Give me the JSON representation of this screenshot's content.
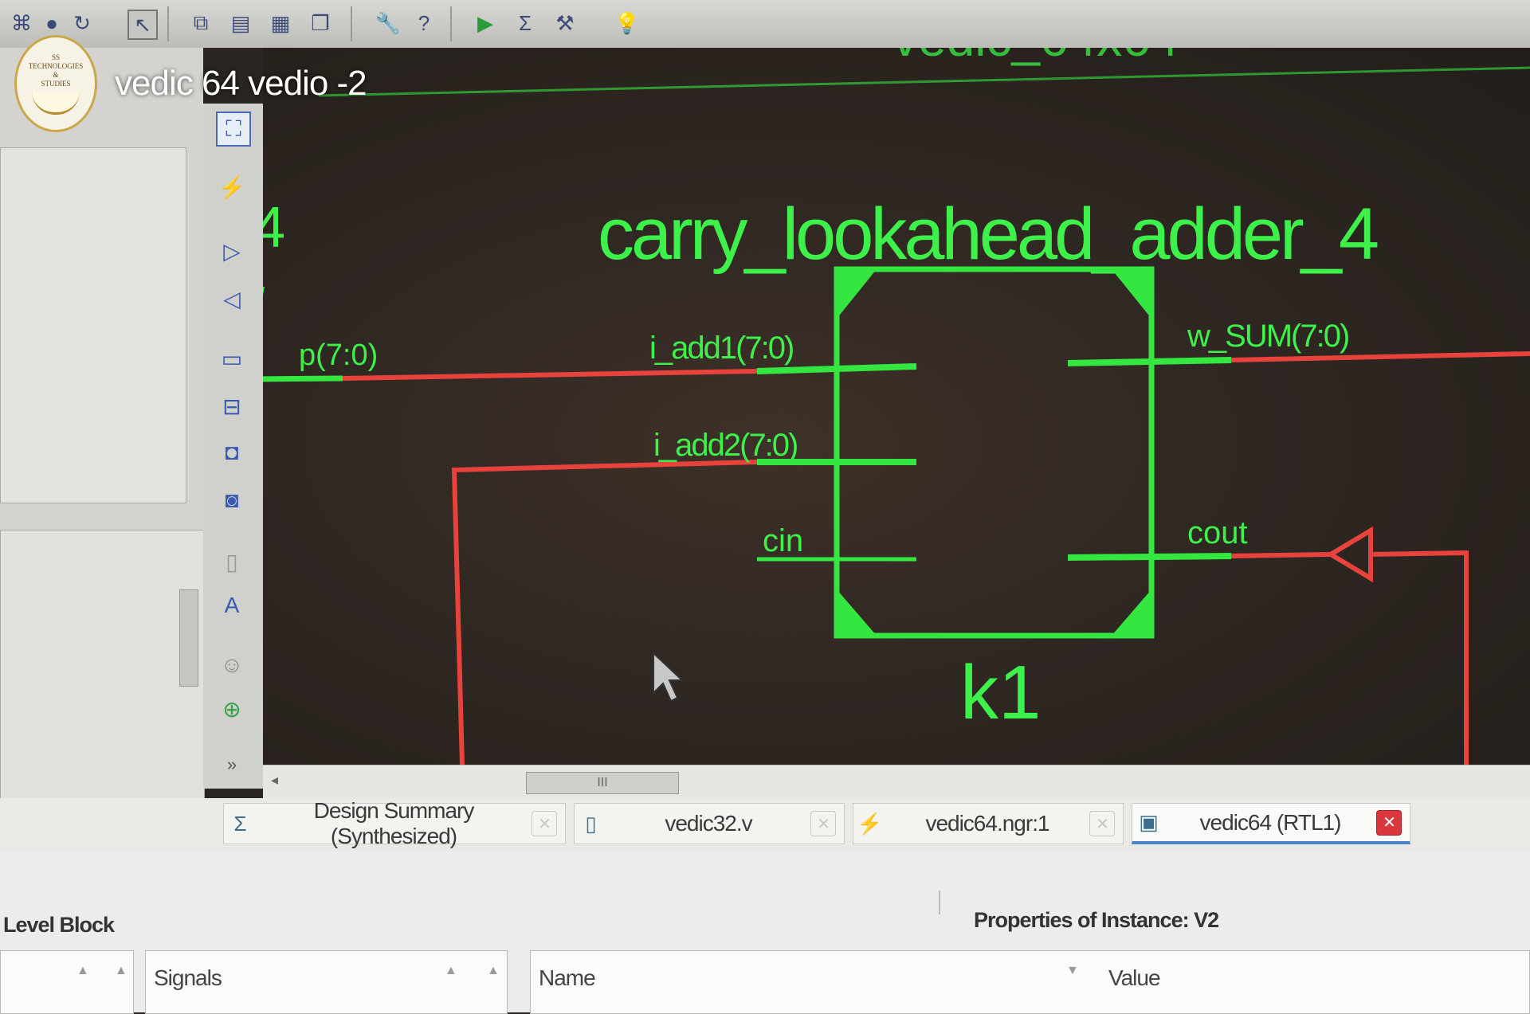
{
  "video": {
    "title": "vedic 64 vedio -2",
    "logo_lines": [
      "SS",
      "TECHNOLOGIES",
      "&",
      "STUDIES"
    ]
  },
  "toolbar": {
    "icons": [
      "hierarchy-icon",
      "record-icon",
      "refresh-icon",
      "pointer-icon",
      "window-cascade-icon",
      "window-split-icon",
      "window-tile-icon",
      "window-float-icon",
      "wrench-icon",
      "help-icon",
      "run-icon",
      "sigma-icon",
      "compile-icon",
      "bulb-icon"
    ]
  },
  "schematic": {
    "header_partial": "vedic_64x64",
    "left_block_partial": "4",
    "left_net": "p(7:0)",
    "block_title": "carry_lookahead_adder_4",
    "instance": "k1",
    "ports": {
      "in1": "i_add1(7:0)",
      "in2": "i_add2(7:0)",
      "cin": "cin",
      "out_sum": "w_SUM(7:0)",
      "cout": "cout"
    },
    "colors": {
      "wire_green": "#34e640",
      "wire_red": "#e8423c",
      "text_green": "#3ef04a"
    }
  },
  "hscroll": {
    "thumb_label": "III"
  },
  "tabs": [
    {
      "icon": "sigma-icon",
      "label": "Design Summary (Synthesized)",
      "active": false
    },
    {
      "icon": "document-icon",
      "label": "vedic32.v",
      "active": false
    },
    {
      "icon": "netlist-icon",
      "label": "vedic64.ngr:1",
      "active": false
    },
    {
      "icon": "schematic-icon",
      "label": "vedic64 (RTL1)",
      "active": true
    }
  ],
  "bottom": {
    "left_title": "Level Block",
    "right_title": "Properties of Instance: V2",
    "signals_header": "Signals",
    "name_header": "Name",
    "value_header": "Value"
  }
}
